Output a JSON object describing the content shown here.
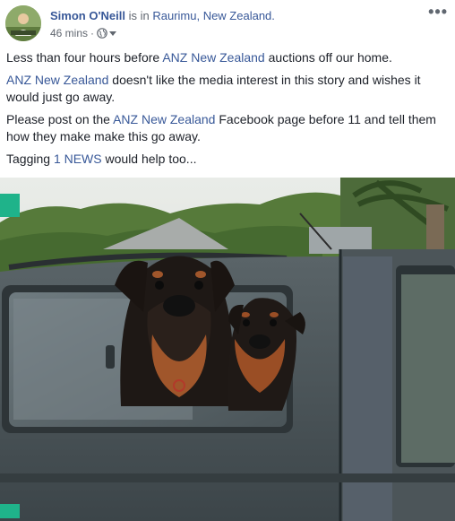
{
  "post": {
    "author": "Simon O'Neill",
    "is_in": " is in ",
    "place": "Raurimu, New Zealand.",
    "timestamp": "46 mins",
    "separator": "·",
    "privacy_icon": "globe-icon",
    "menu_label": "•••"
  },
  "body": {
    "p1": {
      "pre": "Less than four hours before ",
      "link": "ANZ New Zealand",
      "post": " auctions off our home."
    },
    "p2": {
      "link": "ANZ New Zealand",
      "post": " doesn't like the media interest in this story and wishes it would just go away."
    },
    "p3": {
      "pre": "Please post on the ",
      "link": "ANZ New Zealand",
      "post": " Facebook page before 11 and tell them how they make make this go away."
    },
    "p4": {
      "pre": "Tagging ",
      "link": "1 NEWS",
      "post": " would help too..."
    }
  },
  "colors": {
    "link": "#385898",
    "text": "#1d2129",
    "meta": "#616770",
    "accent_corner": "#1fb38a"
  }
}
